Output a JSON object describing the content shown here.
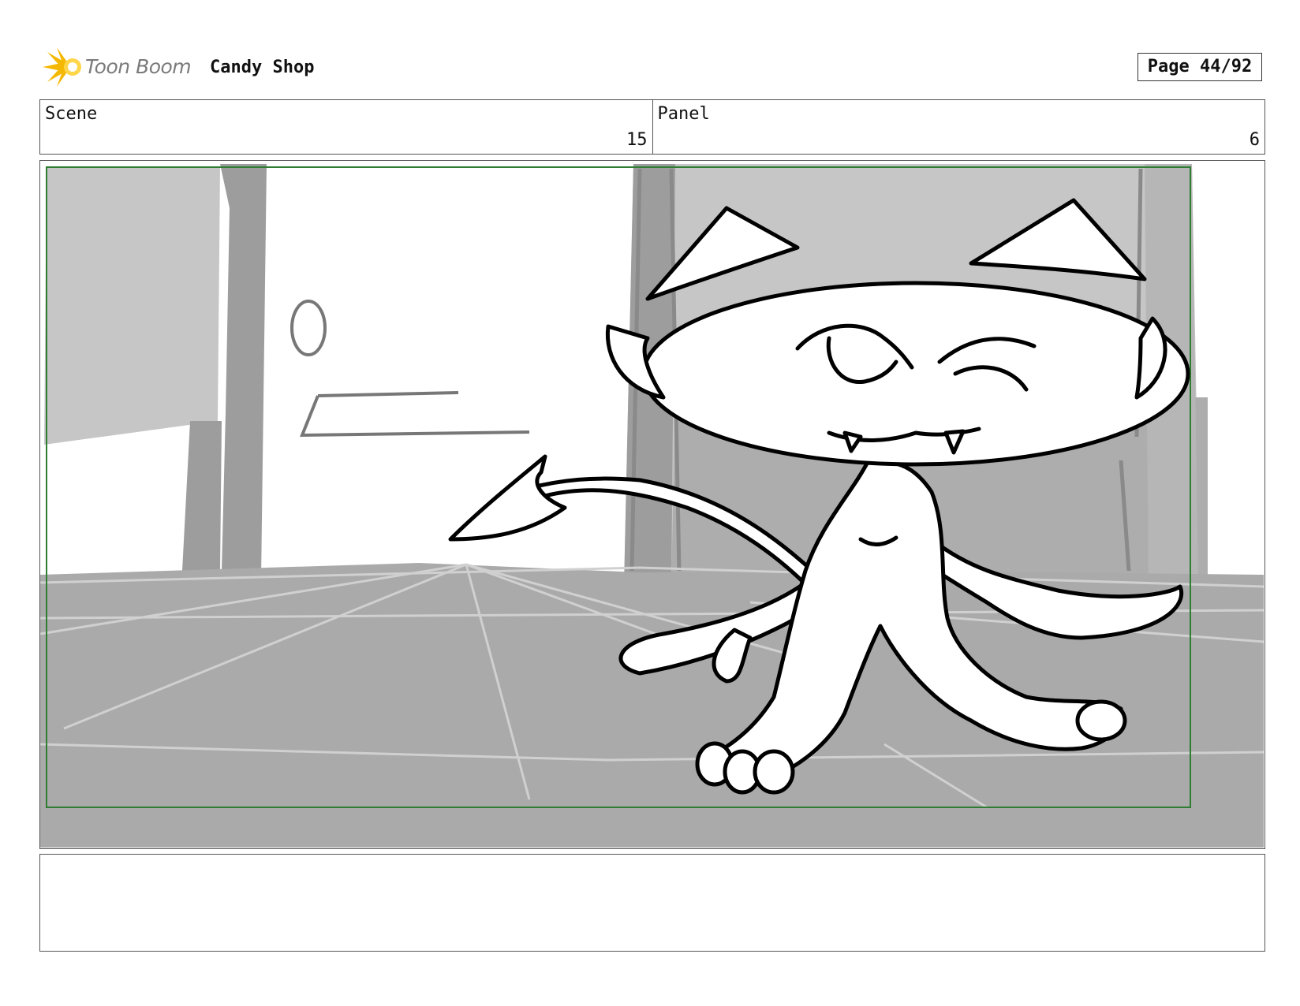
{
  "header": {
    "logo_text": "Toon Boom",
    "project_title": "Candy Shop",
    "page_label": "Page 44/92"
  },
  "info": {
    "scene_label": "Scene",
    "scene_value": "15",
    "panel_label": "Panel",
    "panel_value": "6"
  },
  "notes": {
    "text": ""
  },
  "colors": {
    "safe_frame": "#2e7d32",
    "logo_flare": "#f5b800",
    "wall_gray": "#c6c6c6",
    "floor_gray": "#aaaaaa",
    "ink": "#000000"
  }
}
